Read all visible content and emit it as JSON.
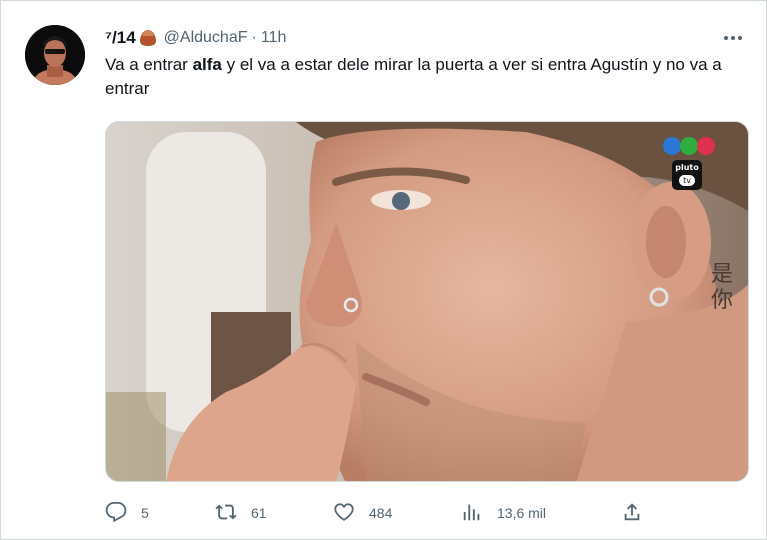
{
  "tweet": {
    "display_name": "⁷/14",
    "handle": "@AlduchaF",
    "separator": "·",
    "time": "11h",
    "text_before": "Va a entrar ",
    "text_bold": "alfa",
    "text_after": " y el va a estar dele mirar la puerta a ver si entra Agustín  y no va a entrar"
  },
  "media": {
    "overlay_logo_text": "pluto",
    "overlay_tv_text": "tv",
    "tattoo_text": "是你"
  },
  "actions": {
    "replies": "5",
    "retweets": "61",
    "likes": "484",
    "views": "13,6 mil"
  },
  "icons": [
    "more-icon",
    "nut-icon",
    "reply-icon",
    "retweet-icon",
    "like-icon",
    "views-icon",
    "share-icon"
  ],
  "colors": {
    "muted": "#536471",
    "text": "#0f1419",
    "border": "#cfd9de"
  }
}
